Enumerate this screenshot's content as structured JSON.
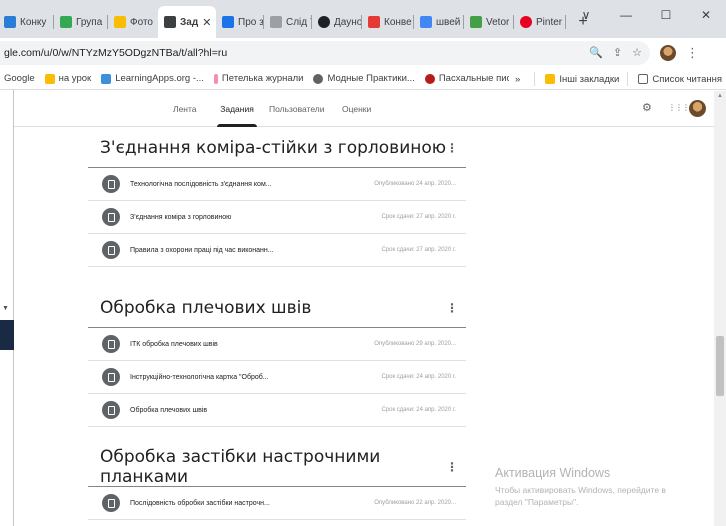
{
  "browser": {
    "tabs": [
      {
        "label": "Конку",
        "color": "#2a7dd6"
      },
      {
        "label": "Група",
        "color": "#34a853"
      },
      {
        "label": "Фото",
        "color": "#fbbc04"
      },
      {
        "label": "Зад",
        "color": "#3c4043",
        "active": true
      },
      {
        "label": "Про з",
        "color": "#1a73e8"
      },
      {
        "label": "Слід 7",
        "color": "#9aa0a6"
      },
      {
        "label": "Дауно",
        "color": "#202124"
      },
      {
        "label": "Конве",
        "color": "#e53935"
      },
      {
        "label": "швей",
        "color": "#4285f4"
      },
      {
        "label": "Vetor",
        "color": "#43a047"
      },
      {
        "label": "Pinter",
        "color": "#e60023"
      }
    ],
    "newtab": "+",
    "winctl": {
      "chevron": "∨",
      "minimize": "—",
      "maximize": "☐",
      "close": "✕"
    },
    "url_main": "gle.com/u/0/w/NTYzMzY5ODgzNTBa/t/all?hl=ru",
    "url_suffix": "",
    "addr_icons": {
      "zoom": "🔍",
      "share": "⇪",
      "star": "☆"
    },
    "menu_dots": "⋮",
    "bookmarks": [
      {
        "label": "Google",
        "color": "#4285f4"
      },
      {
        "label": "на урок",
        "color": "#fbbc04"
      },
      {
        "label": "LearningApps.org -...",
        "color": "#3d8fd8"
      },
      {
        "label": "Петелька журнали",
        "color": "#f48fb1"
      },
      {
        "label": "Модные Практики...",
        "color": "#5f6368"
      },
      {
        "label": "Пасхальные писан...",
        "color": "#b71c1c"
      }
    ],
    "bookmarks_more": "»",
    "bookmarks_right": [
      {
        "label": "Інші закладки",
        "color": "#fbbc04"
      },
      {
        "label": "Список читання",
        "color": "#5f6368"
      }
    ]
  },
  "classroom": {
    "nav_tabs": [
      "Лента",
      "Задания",
      "Пользователи",
      "Оценки"
    ],
    "active_tab": "Задания",
    "icons": {
      "settings": "⚙",
      "apps": "⋮⋮⋮"
    }
  },
  "topics": [
    {
      "title": "З'єднання коміра-стійки з горловиною",
      "items": [
        {
          "title": "Технологічна послідовність з'єднання ком...",
          "date": "Опубликовано 24 апр. 2020..."
        },
        {
          "title": "З'єднання коміра з горловиною",
          "date": "Срок сдачи: 27 апр. 2020 г."
        },
        {
          "title": "Правила з охорони праці під час виконанн...",
          "date": "Срок сдачи: 27 апр. 2020 г."
        }
      ]
    },
    {
      "title": "Обробка плечових швів",
      "items": [
        {
          "title": "ІТК обробка плечових швів",
          "date": "Опубликовано 29 апр. 2020..."
        },
        {
          "title": "Інструкційно-технологічна картка \"Оброб...",
          "date": "Срок сдачи: 24 апр. 2020 г."
        },
        {
          "title": "Обробка плечових швів",
          "date": "Срок сдачи: 24 апр. 2020 г."
        }
      ]
    },
    {
      "title": "Обробка застібки настрочними планками",
      "items": [
        {
          "title": "Послідовність обробки застібки настрочн...",
          "date": "Опубликовано 22 апр. 2020..."
        }
      ]
    }
  ],
  "watermark": {
    "title": "Активация Windows",
    "line1": "Чтобы активировать Windows, перейдите в",
    "line2": "раздел \"Параметры\"."
  }
}
